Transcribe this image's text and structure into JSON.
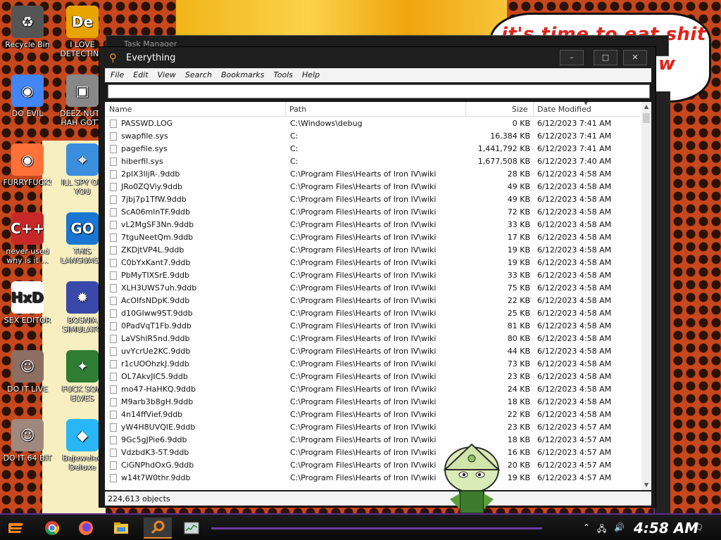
{
  "desktop": {
    "icons": [
      {
        "label": "Recycle Bin",
        "icon": "recycle-bin-icon"
      },
      {
        "label": "I LOVE DETECTING",
        "icon": "game-icon"
      },
      {
        "label": "DO EVIL",
        "icon": "chrome-icon"
      },
      {
        "label": "DEEZ NUTZ HAH GOTTI",
        "icon": "folder-icon"
      },
      {
        "label": "FURRYFUCK!",
        "icon": "firefox-icon"
      },
      {
        "label": "ILL SPY ON YOU",
        "icon": "spy-icon"
      },
      {
        "label": "never used why is it ...",
        "icon": "devcpp-icon"
      },
      {
        "label": "THIS LANGUAGE",
        "icon": "go-icon"
      },
      {
        "label": "SEX EDITOR",
        "icon": "hxd-icon"
      },
      {
        "label": "BOSNIA SIMULATO",
        "icon": "mine-icon"
      },
      {
        "label": "DO IT LIVE",
        "icon": "portrait-icon"
      },
      {
        "label": "FUCK SOM ELVES",
        "icon": "santa-icon"
      },
      {
        "label": "DO IT 64 BIT",
        "icon": "portrait-64-icon"
      },
      {
        "label": "Bejeweled Deluxe",
        "icon": "gem-icon"
      }
    ],
    "speech_bubble": {
      "line1": "it's time to eat shit",
      "line2": "w"
    }
  },
  "background_window": {
    "title": "Task Manager"
  },
  "window": {
    "title": "Everything",
    "controls": {
      "minimize": "–",
      "maximize": "□",
      "close": "✕"
    },
    "menu": [
      "File",
      "Edit",
      "View",
      "Search",
      "Bookmarks",
      "Tools",
      "Help"
    ],
    "search_value": "",
    "columns": {
      "name": "Name",
      "path": "Path",
      "size": "Size",
      "date": "Date Modified"
    },
    "rows": [
      {
        "name": "PASSWD.LOG",
        "path": "C:\\Windows\\debug",
        "size": "0 KB",
        "date": "6/12/2023 7:41 AM"
      },
      {
        "name": "swapfile.sys",
        "path": "C:",
        "size": "16,384 KB",
        "date": "6/12/2023 7:41 AM"
      },
      {
        "name": "pagefile.sys",
        "path": "C:",
        "size": "1,441,792 KB",
        "date": "6/12/2023 7:41 AM"
      },
      {
        "name": "hiberfil.sys",
        "path": "C:",
        "size": "1,677,508 KB",
        "date": "6/12/2023 7:40 AM"
      },
      {
        "name": "2plX3lljR-.9ddb",
        "path": "C:\\Program Files\\Hearts of Iron IV\\wiki",
        "size": "28 KB",
        "date": "6/12/2023 4:58 AM"
      },
      {
        "name": "JRo0ZQViy.9ddb",
        "path": "C:\\Program Files\\Hearts of Iron IV\\wiki",
        "size": "49 KB",
        "date": "6/12/2023 4:58 AM"
      },
      {
        "name": "7jbj7p1TfW.9ddb",
        "path": "C:\\Program Files\\Hearts of Iron IV\\wiki",
        "size": "49 KB",
        "date": "6/12/2023 4:58 AM"
      },
      {
        "name": "ScA06mlnTF.9ddb",
        "path": "C:\\Program Files\\Hearts of Iron IV\\wiki",
        "size": "72 KB",
        "date": "6/12/2023 4:58 AM"
      },
      {
        "name": "vL2MgSF3Nn.9ddb",
        "path": "C:\\Program Files\\Hearts of Iron IV\\wiki",
        "size": "33 KB",
        "date": "6/12/2023 4:58 AM"
      },
      {
        "name": "7tguNeetQm.9ddb",
        "path": "C:\\Program Files\\Hearts of Iron IV\\wiki",
        "size": "17 KB",
        "date": "6/12/2023 4:58 AM"
      },
      {
        "name": "ZKDjtVP4L.9ddb",
        "path": "C:\\Program Files\\Hearts of Iron IV\\wiki",
        "size": "19 KB",
        "date": "6/12/2023 4:58 AM"
      },
      {
        "name": "C0bYxKant7.9ddb",
        "path": "C:\\Program Files\\Hearts of Iron IV\\wiki",
        "size": "19 KB",
        "date": "6/12/2023 4:58 AM"
      },
      {
        "name": "PbMyTIXSrE.9ddb",
        "path": "C:\\Program Files\\Hearts of Iron IV\\wiki",
        "size": "33 KB",
        "date": "6/12/2023 4:58 AM"
      },
      {
        "name": "XLH3UWS7uh.9ddb",
        "path": "C:\\Program Files\\Hearts of Iron IV\\wiki",
        "size": "75 KB",
        "date": "6/12/2023 4:58 AM"
      },
      {
        "name": "AcOIfsNDpK.9ddb",
        "path": "C:\\Program Files\\Hearts of Iron IV\\wiki",
        "size": "22 KB",
        "date": "6/12/2023 4:58 AM"
      },
      {
        "name": "d10GIww9ST.9ddb",
        "path": "C:\\Program Files\\Hearts of Iron IV\\wiki",
        "size": "25 KB",
        "date": "6/12/2023 4:58 AM"
      },
      {
        "name": "0PadVqT1Fb.9ddb",
        "path": "C:\\Program Files\\Hearts of Iron IV\\wiki",
        "size": "81 KB",
        "date": "6/12/2023 4:58 AM"
      },
      {
        "name": "LaVShlR5nd.9ddb",
        "path": "C:\\Program Files\\Hearts of Iron IV\\wiki",
        "size": "80 KB",
        "date": "6/12/2023 4:58 AM"
      },
      {
        "name": "uvYcrUe2KC.9ddb",
        "path": "C:\\Program Files\\Hearts of Iron IV\\wiki",
        "size": "44 KB",
        "date": "6/12/2023 4:58 AM"
      },
      {
        "name": "r1cUOOhzkJ.9ddb",
        "path": "C:\\Program Files\\Hearts of Iron IV\\wiki",
        "size": "73 KB",
        "date": "6/12/2023 4:58 AM"
      },
      {
        "name": "OL7AkvJIC5.9ddb",
        "path": "C:\\Program Files\\Hearts of Iron IV\\wiki",
        "size": "23 KB",
        "date": "6/12/2023 4:58 AM"
      },
      {
        "name": "mo47-HaHKQ.9ddb",
        "path": "C:\\Program Files\\Hearts of Iron IV\\wiki",
        "size": "24 KB",
        "date": "6/12/2023 4:58 AM"
      },
      {
        "name": "M9arb3b8gH.9ddb",
        "path": "C:\\Program Files\\Hearts of Iron IV\\wiki",
        "size": "18 KB",
        "date": "6/12/2023 4:58 AM"
      },
      {
        "name": "4n14ffVief.9ddb",
        "path": "C:\\Program Files\\Hearts of Iron IV\\wiki",
        "size": "22 KB",
        "date": "6/12/2023 4:58 AM"
      },
      {
        "name": "yW4H8UVQlE.9ddb",
        "path": "C:\\Program Files\\Hearts of Iron IV\\wiki",
        "size": "23 KB",
        "date": "6/12/2023 4:57 AM"
      },
      {
        "name": "9Gc5gJPie6.9ddb",
        "path": "C:\\Program Files\\Hearts of Iron IV\\wiki",
        "size": "18 KB",
        "date": "6/12/2023 4:57 AM"
      },
      {
        "name": "VdzbdK3-5T.9ddb",
        "path": "C:\\Program Files\\Hearts of Iron IV\\wiki",
        "size": "16 KB",
        "date": "6/12/2023 4:57 AM"
      },
      {
        "name": "CiGNPhdOxG.9ddb",
        "path": "C:\\Program Files\\Hearts of Iron IV\\wiki",
        "size": "20 KB",
        "date": "6/12/2023 4:57 AM"
      },
      {
        "name": "w14t7W0thr.9ddb",
        "path": "C:\\Program Files\\Hearts of Iron IV\\wiki",
        "size": "19 KB",
        "date": "6/12/2023 4:57 AM"
      }
    ],
    "status": "224,613 objects"
  },
  "taskbar": {
    "clock": "4:58 AM",
    "apps": [
      "start-icon",
      "chrome-icon",
      "firefox-icon",
      "file-explorer-icon",
      "everything-icon",
      "task-manager-icon"
    ]
  },
  "colors": {
    "accent": "#f08a24",
    "title_bar": "#1f1f1f",
    "taskbar_border": "#5b2c8e"
  }
}
